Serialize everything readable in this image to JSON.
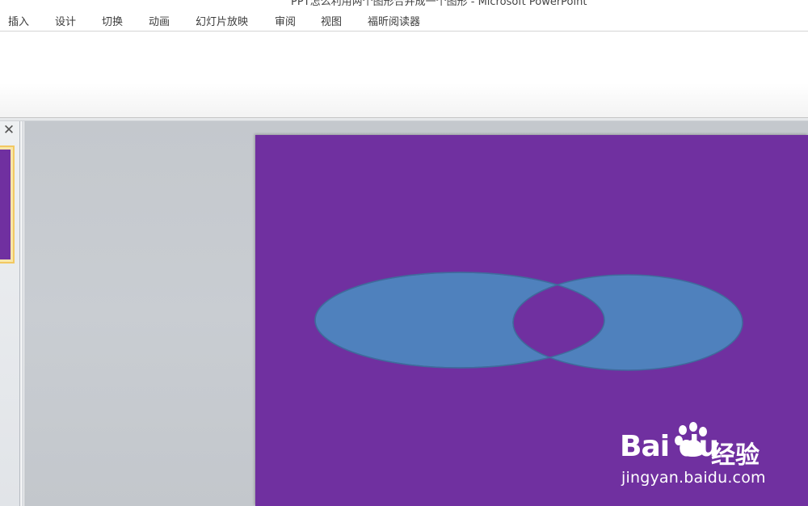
{
  "window": {
    "title": "PPT怎么利用两个图形合并成一个图形 - Microsoft PowerPoint"
  },
  "ribbon": {
    "tabs": [
      {
        "label": "插入"
      },
      {
        "label": "设计"
      },
      {
        "label": "切换"
      },
      {
        "label": "动画"
      },
      {
        "label": "幻灯片放映"
      },
      {
        "label": "审阅"
      },
      {
        "label": "视图"
      },
      {
        "label": "福昕阅读器"
      }
    ]
  },
  "thumbnails": {
    "close_glyph": "✕"
  },
  "slide": {
    "background_color": "#7030a0",
    "shape_fill": "#4f81bd",
    "shape_outline": "#3f6b9c"
  },
  "watermark": {
    "brand": "Bai du",
    "product": "经验",
    "url": "jingyan.baidu.com"
  }
}
